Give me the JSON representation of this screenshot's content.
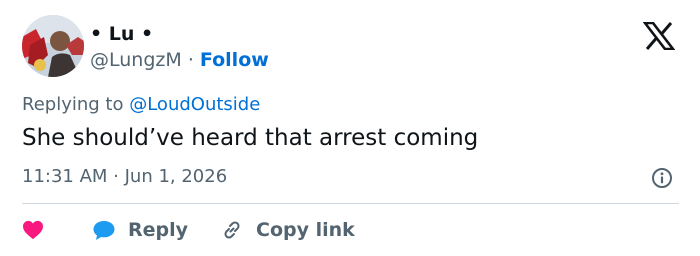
{
  "tweet": {
    "author_name": "• Lu •",
    "author_handle": "@LungzM",
    "separator": "·",
    "follow_label": "Follow",
    "replying_prefix": "Replying to",
    "replying_handle": "@LoudOutside",
    "text": "She should’ve heard that arrest coming",
    "timestamp": "11:31 AM · Jun 1, 2026"
  },
  "actions": {
    "reply_label": "Reply",
    "copy_link_label": "Copy link"
  },
  "icons": {
    "logo": "x-logo-icon",
    "info": "info-icon",
    "like": "heart-icon",
    "reply": "speech-bubble-icon",
    "copy": "link-icon"
  },
  "colors": {
    "accent": "#006fd6",
    "muted_text": "#536471",
    "main_text": "#0f1419",
    "like": "#f91880",
    "reply_bubble": "#1d9bf0",
    "divider": "#cfd9de"
  }
}
